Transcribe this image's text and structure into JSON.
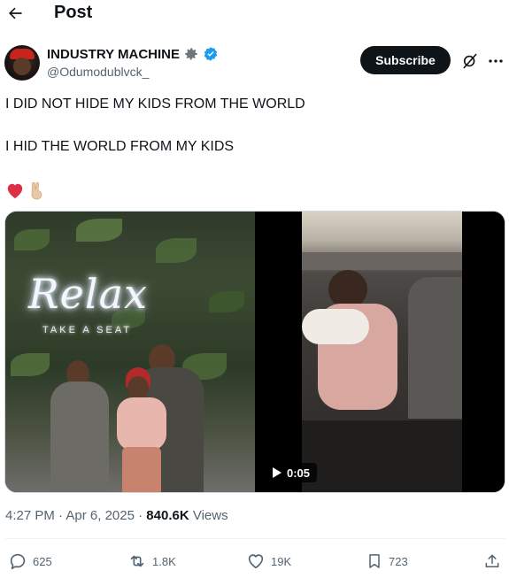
{
  "header": {
    "title": "Post",
    "back_icon": "arrow-left-icon"
  },
  "author": {
    "name": "INDUSTRY MACHINE",
    "handle": "@Odumodublvck_",
    "badge_icon": "gear-badge-icon",
    "verified_icon": "verified-badge-icon",
    "verified_color": "#1d9bf0"
  },
  "actions_top": {
    "subscribe_label": "Subscribe",
    "grok_icon": "grok-icon",
    "more_icon": "more-icon"
  },
  "tweet": {
    "line1": "I DID NOT HIDE MY KIDS FROM THE WORLD",
    "line2": "I HID THE WORLD FROM MY KIDS",
    "emojis": [
      "red-heart-emoji",
      "victory-hand-emoji"
    ]
  },
  "media": {
    "photo_sign": "Relax",
    "photo_sign_sub": "TAKE A SEAT",
    "video_duration": "0:05",
    "play_icon": "play-icon"
  },
  "meta": {
    "time": "4:27 PM",
    "date": "Apr 6, 2025",
    "separator": "·",
    "views_count": "840.6K",
    "views_label": "Views"
  },
  "engagement": {
    "replies": "625",
    "reposts": "1.8K",
    "likes": "19K",
    "bookmarks": "723"
  },
  "colors": {
    "text": "#0f1419",
    "muted": "#536471",
    "accent": "#1d9bf0",
    "button_bg": "#0f1419"
  }
}
